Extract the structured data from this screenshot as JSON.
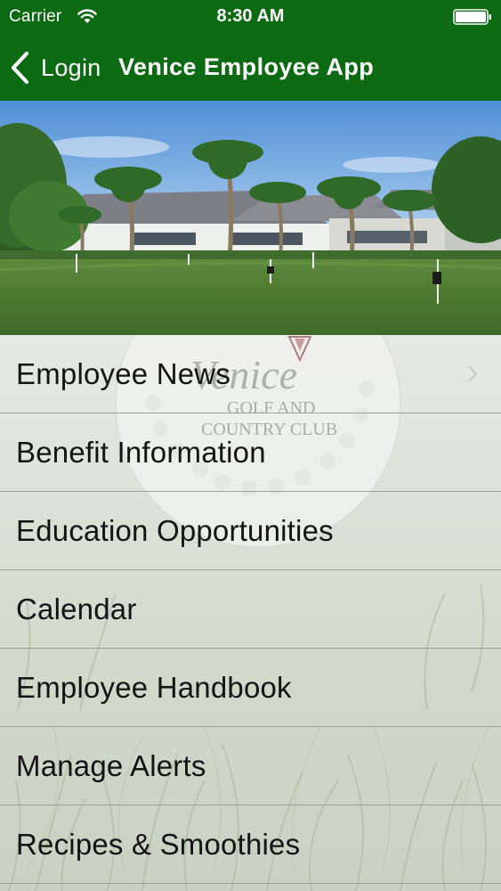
{
  "status_bar": {
    "carrier": "Carrier",
    "time": "8:30 AM",
    "wifi_icon": "wifi-icon",
    "battery_icon": "battery-full-icon"
  },
  "nav": {
    "back_label": "Login",
    "back_icon": "chevron-left-icon",
    "title": "Venice Employee App"
  },
  "hero": {
    "subject": "golf-course-clubhouse-photo"
  },
  "logo": {
    "line1": "Venice",
    "line2": "GOLF AND",
    "line3": "COUNTRY CLUB"
  },
  "menu": {
    "items": [
      {
        "label": "Employee News"
      },
      {
        "label": "Benefit Information"
      },
      {
        "label": "Education Opportunities"
      },
      {
        "label": "Calendar"
      },
      {
        "label": "Employee Handbook"
      },
      {
        "label": "Manage Alerts"
      },
      {
        "label": "Recipes & Smoothies"
      }
    ],
    "chevron_icon": "chevron-right-icon"
  },
  "colors": {
    "brand_green": "#0c6a12",
    "text": "#141414",
    "separator": "#9aa295"
  }
}
